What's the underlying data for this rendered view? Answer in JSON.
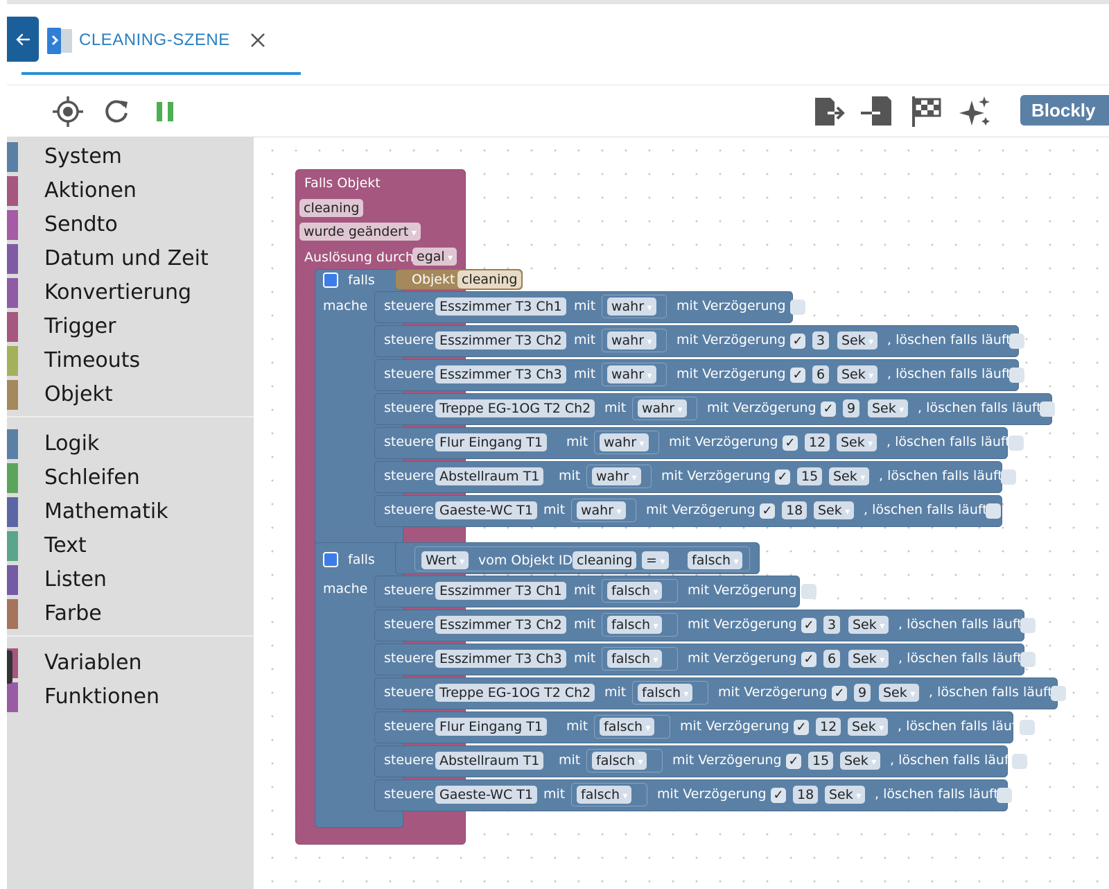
{
  "tab": {
    "title": "CLEANING-SZENE"
  },
  "toolbar": {
    "blockly_label": "Blockly"
  },
  "sidebar": {
    "group1": [
      "System",
      "Aktionen",
      "Sendto",
      "Datum und Zeit",
      "Konvertierung",
      "Trigger",
      "Timeouts",
      "Objekt"
    ],
    "group2": [
      "Logik",
      "Schleifen",
      "Mathematik",
      "Text",
      "Listen",
      "Farbe"
    ],
    "group3": [
      "Variablen",
      "Funktionen"
    ]
  },
  "colors": {
    "sidebar_bars": [
      "#5b80a5",
      "#a5577f",
      "#a55ba5",
      "#7f5ba5",
      "#8e5ba5",
      "#a5577f",
      "#a5b05b",
      "#a5885b",
      "#5b80a5",
      "#5ba55b",
      "#5b67a5",
      "#5ba58c",
      "#745ba5",
      "#a5745b",
      "#a5577f",
      "#9a5ba5"
    ],
    "trigger_block": "#a5577f",
    "control_block": "#5b80a5",
    "object_block": "#a5885b"
  },
  "script": {
    "trigger": {
      "header": "Falls Objekt",
      "object": "cleaning",
      "event": "wurde geändert",
      "by_label": "Auslösung durch",
      "by_value": "egal"
    },
    "kw": {
      "falls": "falls",
      "mache": "mache",
      "steuere": "steuere",
      "mit": "mit",
      "delay": "mit Verzögerung",
      "clear": ", löschen falls läuft",
      "sek": "Sek",
      "check": "✓"
    },
    "if1": {
      "cond_label": "Objekt",
      "cond_object": "cleaning",
      "rows": [
        {
          "device": "Esszimmer T3 Ch1",
          "value": "wahr",
          "delay": false,
          "seconds": ""
        },
        {
          "device": "Esszimmer T3 Ch2",
          "value": "wahr",
          "delay": true,
          "seconds": "3"
        },
        {
          "device": "Esszimmer T3 Ch3",
          "value": "wahr",
          "delay": true,
          "seconds": "6"
        },
        {
          "device": "Treppe EG-1OG T2 Ch2",
          "value": "wahr",
          "delay": true,
          "seconds": "9"
        },
        {
          "device": "Flur Eingang T1",
          "value": "wahr",
          "delay": true,
          "seconds": "12"
        },
        {
          "device": "Abstellraum T1",
          "value": "wahr",
          "delay": true,
          "seconds": "15"
        },
        {
          "device": "Gaeste-WC T1",
          "value": "wahr",
          "delay": true,
          "seconds": "18"
        }
      ]
    },
    "if2": {
      "cond_prop": "Wert",
      "cond_mid": "vom Objekt ID",
      "cond_object": "cleaning",
      "cond_op": "=",
      "cond_value": "falsch",
      "rows": [
        {
          "device": "Esszimmer T3 Ch1",
          "value": "falsch",
          "delay": false,
          "seconds": ""
        },
        {
          "device": "Esszimmer T3 Ch2",
          "value": "falsch",
          "delay": true,
          "seconds": "3"
        },
        {
          "device": "Esszimmer T3 Ch3",
          "value": "falsch",
          "delay": true,
          "seconds": "6"
        },
        {
          "device": "Treppe EG-1OG T2 Ch2",
          "value": "falsch",
          "delay": true,
          "seconds": "9"
        },
        {
          "device": "Flur Eingang T1",
          "value": "falsch",
          "delay": true,
          "seconds": "12"
        },
        {
          "device": "Abstellraum T1",
          "value": "falsch",
          "delay": true,
          "seconds": "15"
        },
        {
          "device": "Gaeste-WC T1",
          "value": "falsch",
          "delay": true,
          "seconds": "18"
        }
      ]
    }
  }
}
